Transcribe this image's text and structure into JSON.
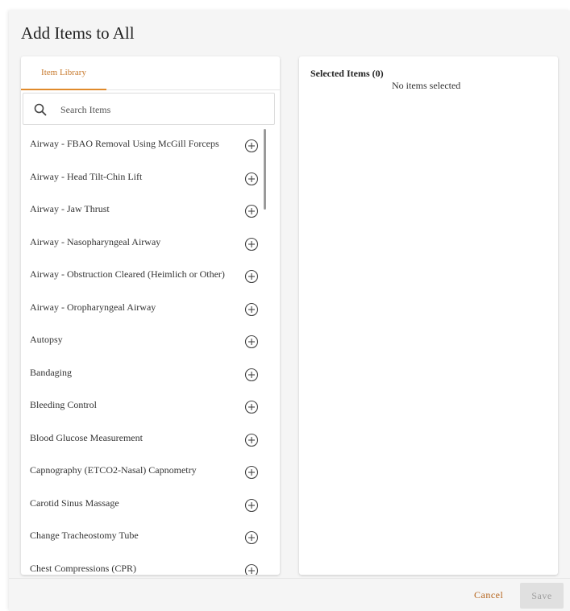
{
  "dialog": {
    "title": "Add Items to All"
  },
  "library": {
    "tab_label": "Item Library",
    "search_placeholder": "Search Items",
    "items": [
      {
        "label": "Airway - FBAO Removal Using McGill Forceps"
      },
      {
        "label": "Airway - Head Tilt-Chin Lift"
      },
      {
        "label": "Airway - Jaw Thrust"
      },
      {
        "label": "Airway - Nasopharyngeal Airway"
      },
      {
        "label": "Airway - Obstruction Cleared (Heimlich or Other)"
      },
      {
        "label": "Airway - Oropharyngeal Airway"
      },
      {
        "label": "Autopsy"
      },
      {
        "label": "Bandaging"
      },
      {
        "label": "Bleeding Control"
      },
      {
        "label": "Blood Glucose Measurement"
      },
      {
        "label": "Capnography (ETCO2-Nasal) Capnometry"
      },
      {
        "label": "Carotid Sinus Massage"
      },
      {
        "label": "Change Tracheostomy Tube"
      },
      {
        "label": "Chest Compressions (CPR)"
      }
    ]
  },
  "selected": {
    "title": "Selected Items (0)",
    "empty_text": "No items selected"
  },
  "footer": {
    "cancel_label": "Cancel",
    "save_label": "Save"
  },
  "icons": {
    "search": "search-icon",
    "add": "add-circle-icon"
  },
  "colors": {
    "accent": "#e08a2b",
    "cancel": "#b5651d",
    "disabled_bg": "#e0e0e0",
    "disabled_text": "#9e9e9e"
  }
}
